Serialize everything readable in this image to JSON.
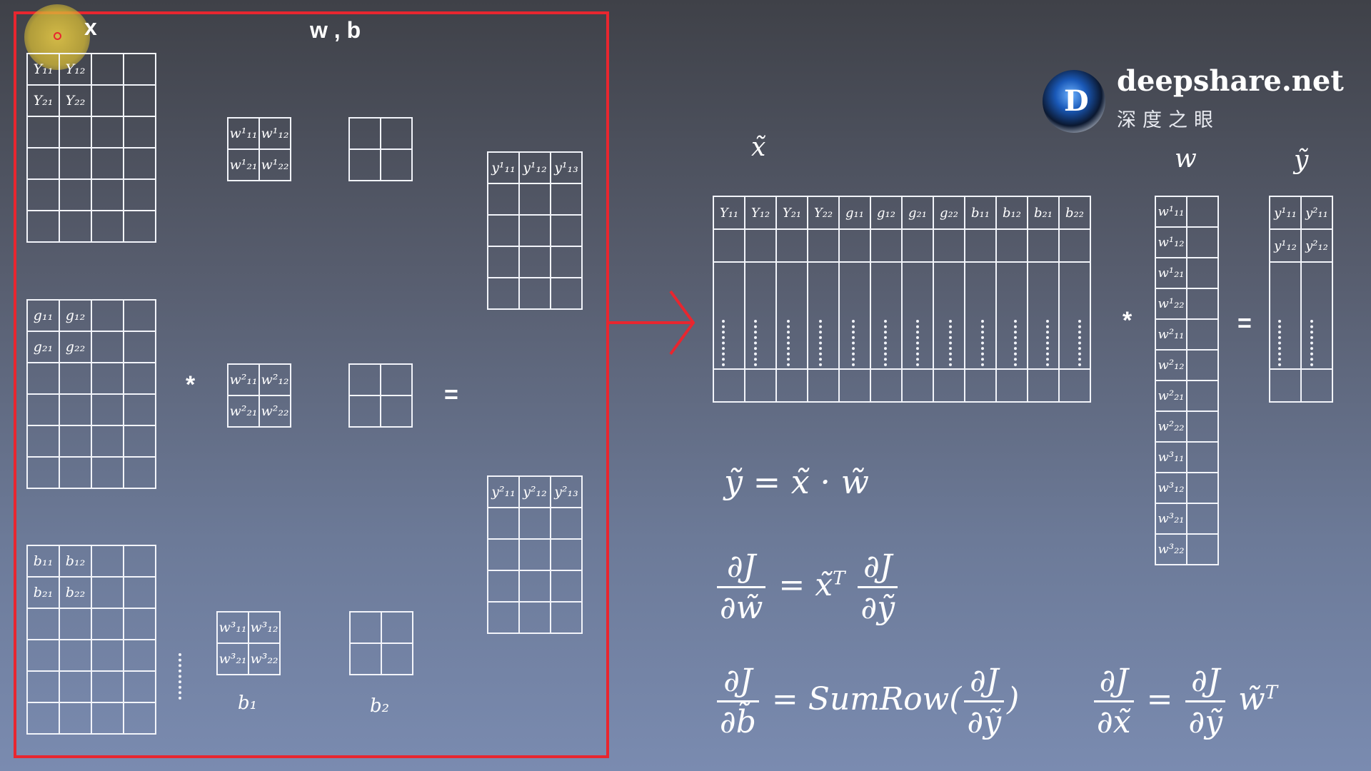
{
  "left_panel": {
    "x_label": "x",
    "wb_label": "w , b",
    "star": "*",
    "eq": "=",
    "b1": "b₁",
    "b2": "b₂",
    "y_grid": [
      [
        "Y₁₁",
        "Y₁₂",
        "",
        ""
      ],
      [
        "Y₂₁",
        "Y₂₂",
        "",
        ""
      ],
      [
        "",
        "",
        "",
        ""
      ],
      [
        "",
        "",
        "",
        ""
      ],
      [
        "",
        "",
        "",
        ""
      ],
      [
        "",
        "",
        "",
        ""
      ]
    ],
    "g_grid": [
      [
        "g₁₁",
        "g₁₂",
        "",
        ""
      ],
      [
        "g₂₁",
        "g₂₂",
        "",
        ""
      ],
      [
        "",
        "",
        "",
        ""
      ],
      [
        "",
        "",
        "",
        ""
      ],
      [
        "",
        "",
        "",
        ""
      ],
      [
        "",
        "",
        "",
        ""
      ]
    ],
    "b_grid": [
      [
        "b₁₁",
        "b₁₂",
        "",
        ""
      ],
      [
        "b₂₁",
        "b₂₂",
        "",
        ""
      ],
      [
        "",
        "",
        "",
        ""
      ],
      [
        "",
        "",
        "",
        ""
      ],
      [
        "",
        "",
        "",
        ""
      ],
      [
        "",
        "",
        "",
        ""
      ]
    ],
    "w1": [
      [
        "w¹₁₁",
        "w¹₁₂"
      ],
      [
        "w¹₂₁",
        "w¹₂₂"
      ]
    ],
    "w2": [
      [
        "w²₁₁",
        "w²₁₂"
      ],
      [
        "w²₂₁",
        "w²₂₂"
      ]
    ],
    "w3": [
      [
        "w³₁₁",
        "w³₁₂"
      ],
      [
        "w³₂₁",
        "w³₂₂"
      ]
    ],
    "out1_head": [
      "y¹₁₁",
      "y¹₁₂",
      "y¹₁₃"
    ],
    "out2_head": [
      "y²₁₁",
      "y²₁₂",
      "y²₁₃"
    ]
  },
  "brand": {
    "name": "deepshare.net",
    "sub": "深度之眼",
    "logo_letter": "D"
  },
  "right_panel": {
    "x_tilde_label": "x̃",
    "w_label": "w",
    "y_tilde_label": "ỹ",
    "star": "*",
    "eq": "=",
    "xt_header": [
      "Y₁₁",
      "Y₁₂",
      "Y₂₁",
      "Y₂₂",
      "g₁₁",
      "g₁₂",
      "g₂₁",
      "g₂₂",
      "b₁₁",
      "b₁₂",
      "b₂₁",
      "b₂₂"
    ],
    "w_col": [
      "w¹₁₁",
      "w¹₁₂",
      "w¹₂₁",
      "w¹₂₂",
      "w²₁₁",
      "w²₁₂",
      "w²₂₁",
      "w²₂₂",
      "w³₁₁",
      "w³₁₂",
      "w³₂₁",
      "w³₂₂"
    ],
    "y_rows": [
      [
        "y¹₁₁",
        "y²₁₁"
      ],
      [
        "y¹₁₂",
        "y²₁₂"
      ]
    ]
  },
  "formulas": {
    "f1": "ỹ = x̃ · w̃",
    "dJ": "∂J",
    "dw": "∂w̃",
    "dy": "∂ỹ",
    "db": "∂b̃",
    "dx": "∂x̃",
    "eq": "=",
    "xT": "x̃",
    "T": "T",
    "sumrow": "SumRow(",
    "close": ")",
    "wT": "w̃"
  }
}
